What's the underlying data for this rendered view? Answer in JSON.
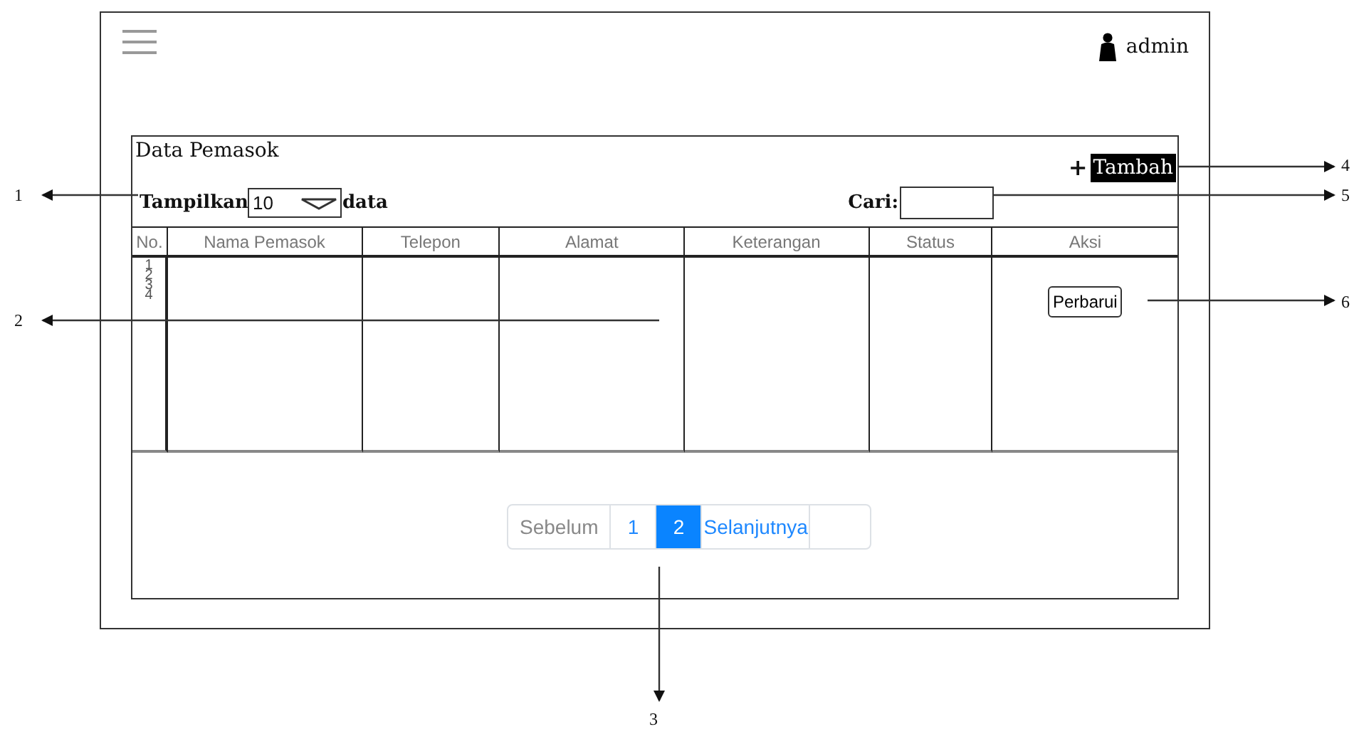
{
  "header": {
    "user": "admin"
  },
  "panel": {
    "title": "Data Pemasok",
    "add_icon": "+",
    "add_label": "Tambah",
    "show_label": "Tampilkan",
    "page_size": "10",
    "show_suffix": "data",
    "search_label": "Cari:",
    "table": {
      "columns": [
        "No.",
        "Nama Pemasok",
        "Telepon",
        "Alamat",
        "Keterangan",
        "Status",
        "Aksi"
      ],
      "row_numbers": [
        "1",
        "2",
        "3",
        "4"
      ],
      "action_button": "Perbarui"
    },
    "pagination": [
      {
        "label": "Sebelum",
        "kind": "prev",
        "selected": false,
        "disabled": true
      },
      {
        "label": "1",
        "kind": "page",
        "selected": false,
        "disabled": false
      },
      {
        "label": "2",
        "kind": "page",
        "selected": true,
        "disabled": false
      },
      {
        "label": "Selanjutnya",
        "kind": "next",
        "selected": false,
        "disabled": false
      }
    ]
  },
  "annotations": [
    {
      "number": "1"
    },
    {
      "number": "2"
    },
    {
      "number": "3"
    },
    {
      "number": "4"
    },
    {
      "number": "5"
    },
    {
      "number": "6"
    }
  ]
}
